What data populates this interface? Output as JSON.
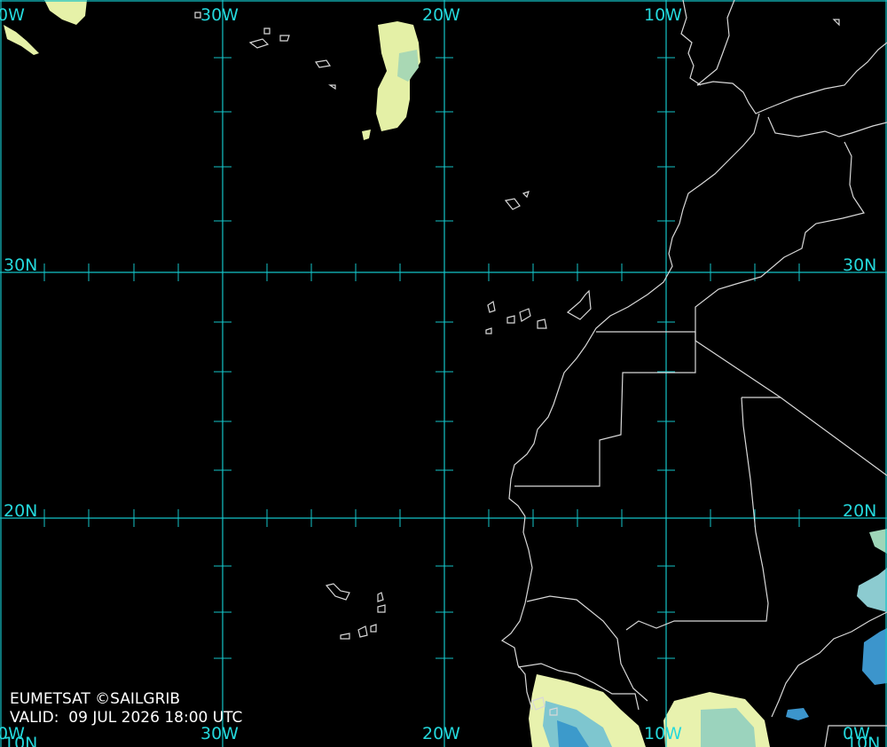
{
  "labels": {
    "lon_top": [
      "0W",
      "30W",
      "20W",
      "10W"
    ],
    "lon_bottom": [
      "0W",
      "30W",
      "20W",
      "10W",
      "0W"
    ],
    "lat_left": [
      "30N",
      "20N"
    ],
    "lat_right": [
      "30N",
      "20N"
    ],
    "corner_left": "10N",
    "corner_right": "10N"
  },
  "caption": {
    "credit": "EUMETSAT ©SAILGRIB",
    "valid_label": "VALID:",
    "valid_time": "09 JUL 2026 18:00 UTC"
  },
  "colors": {
    "grid": "#14c4c8",
    "coast": "#d8d8d8",
    "cloud_light": "#eef5b0",
    "cloud_mid": "#9fd6b8",
    "cloud_deep": "#2f8fc8"
  }
}
